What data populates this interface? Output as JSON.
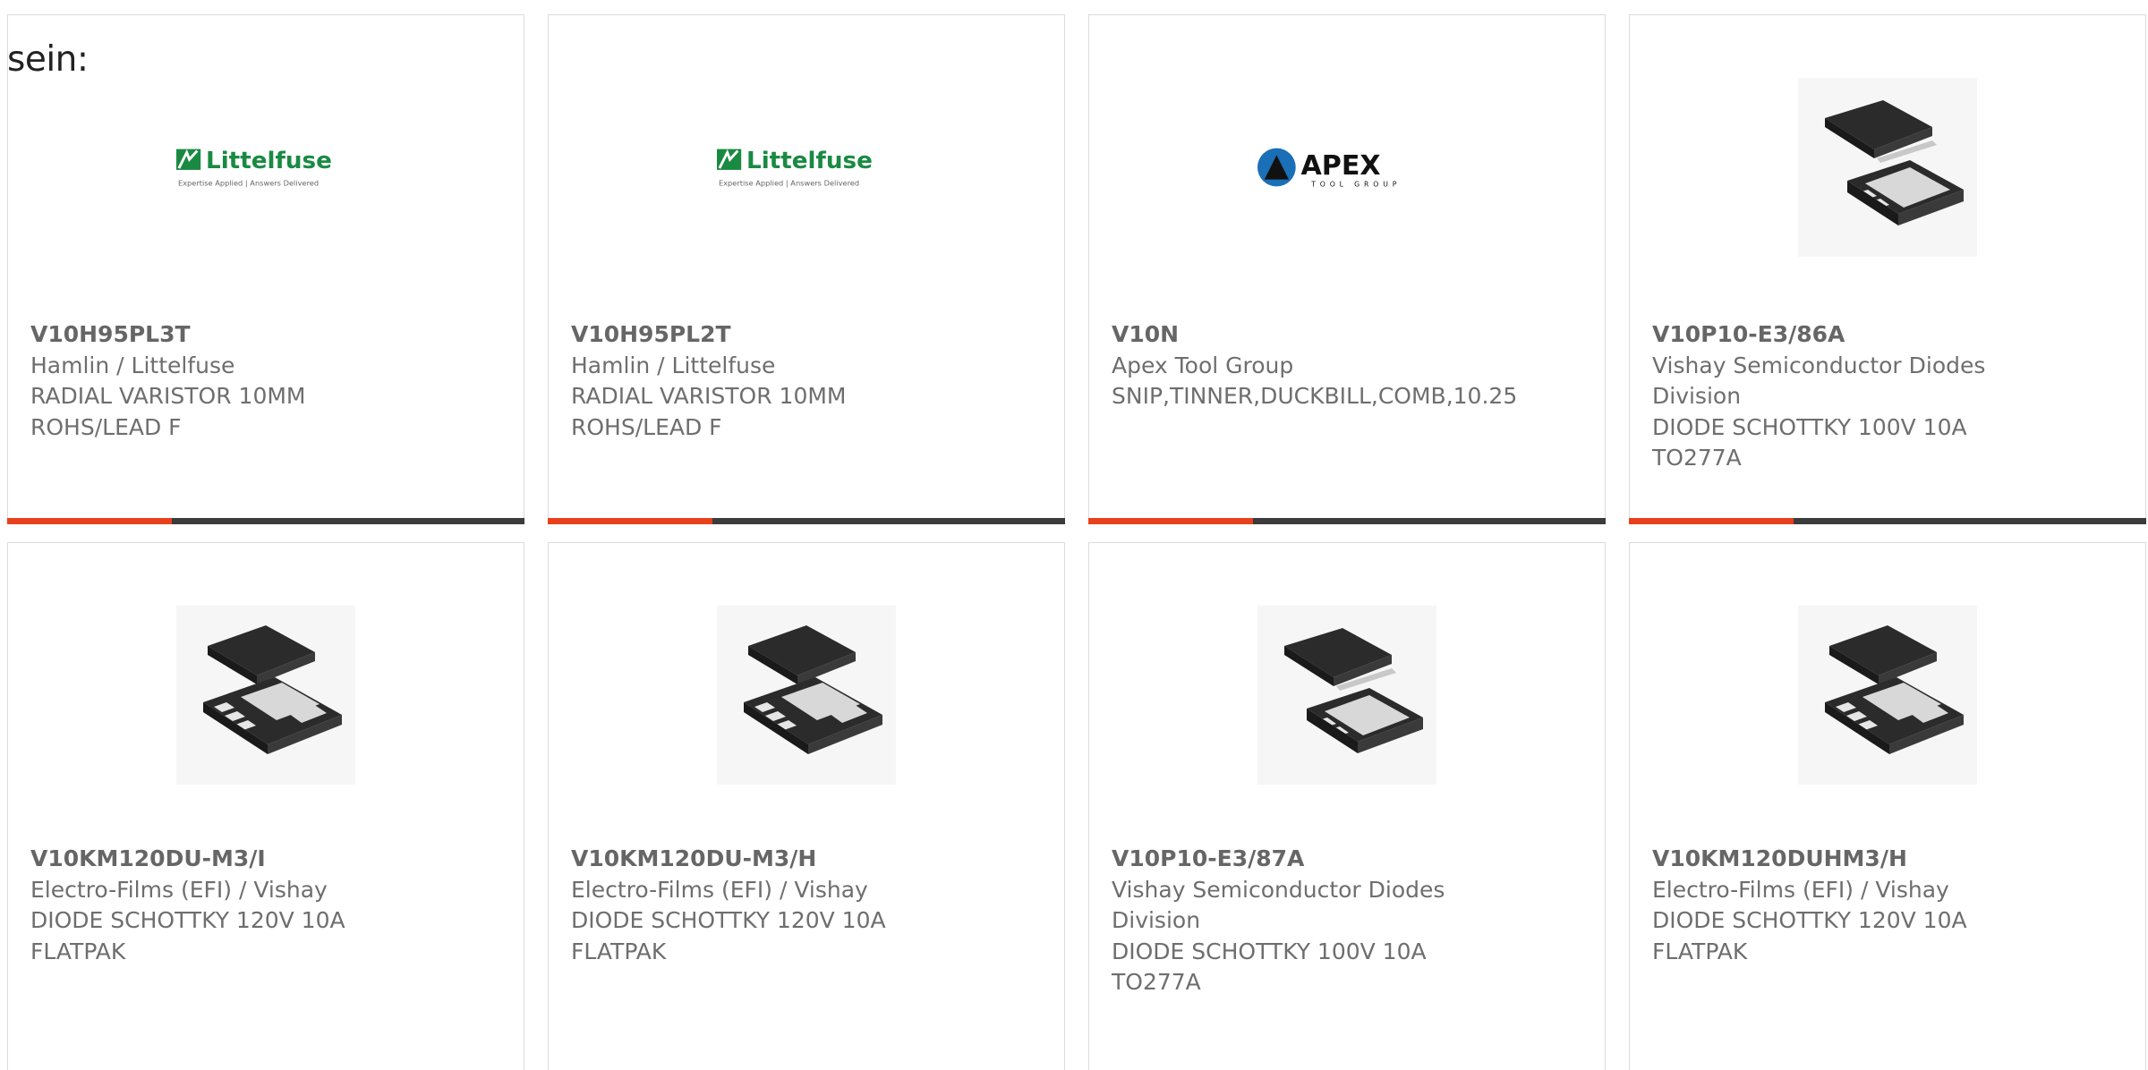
{
  "intro_text": "sein:",
  "colors": {
    "accent": "#e8401c",
    "bar": "#3b3b3b",
    "text": "#666666",
    "littelfuse_green": "#1a8a43"
  },
  "products": [
    {
      "part": "V10H95PL3T",
      "maker": "Hamlin / Littelfuse",
      "desc1": "RADIAL VARISTOR 10MM",
      "desc2": "ROHS/LEAD F",
      "image": "littelfuse-logo",
      "logo_name": "Littelfuse",
      "logo_tagline": "Expertise Applied | Answers Delivered"
    },
    {
      "part": "V10H95PL2T",
      "maker": "Hamlin / Littelfuse",
      "desc1": "RADIAL VARISTOR 10MM",
      "desc2": "ROHS/LEAD F",
      "image": "littelfuse-logo",
      "logo_name": "Littelfuse",
      "logo_tagline": "Expertise Applied | Answers Delivered"
    },
    {
      "part": "V10N",
      "maker": "Apex Tool Group",
      "desc1": "SNIP,TINNER,DUCKBILL,COMB,10.25",
      "desc2": "",
      "image": "apex-logo",
      "logo_name": "APEX",
      "logo_tagline": "TOOL GROUP"
    },
    {
      "part": "V10P10-E3/86A",
      "maker": "Vishay Semiconductor Diodes",
      "maker2": "Division",
      "desc1": "DIODE SCHOTTKY 100V 10A",
      "desc2": "TO277A",
      "image": "to277a-package"
    },
    {
      "part": "V10KM120DU-M3/I",
      "maker": "Electro-Films (EFI) / Vishay",
      "desc1": "DIODE SCHOTTKY 120V 10A",
      "desc2": "FLATPAK",
      "image": "flatpak-package"
    },
    {
      "part": "V10KM120DU-M3/H",
      "maker": "Electro-Films (EFI) / Vishay",
      "desc1": "DIODE SCHOTTKY 120V 10A",
      "desc2": "FLATPAK",
      "image": "flatpak-package"
    },
    {
      "part": "V10P10-E3/87A",
      "maker": "Vishay Semiconductor Diodes",
      "maker2": "Division",
      "desc1": "DIODE SCHOTTKY 100V 10A",
      "desc2": "TO277A",
      "image": "to277a-package"
    },
    {
      "part": "V10KM120DUHM3/H",
      "maker": "Electro-Films (EFI) / Vishay",
      "desc1": "DIODE SCHOTTKY 120V 10A",
      "desc2": "FLATPAK",
      "image": "flatpak-package"
    }
  ]
}
